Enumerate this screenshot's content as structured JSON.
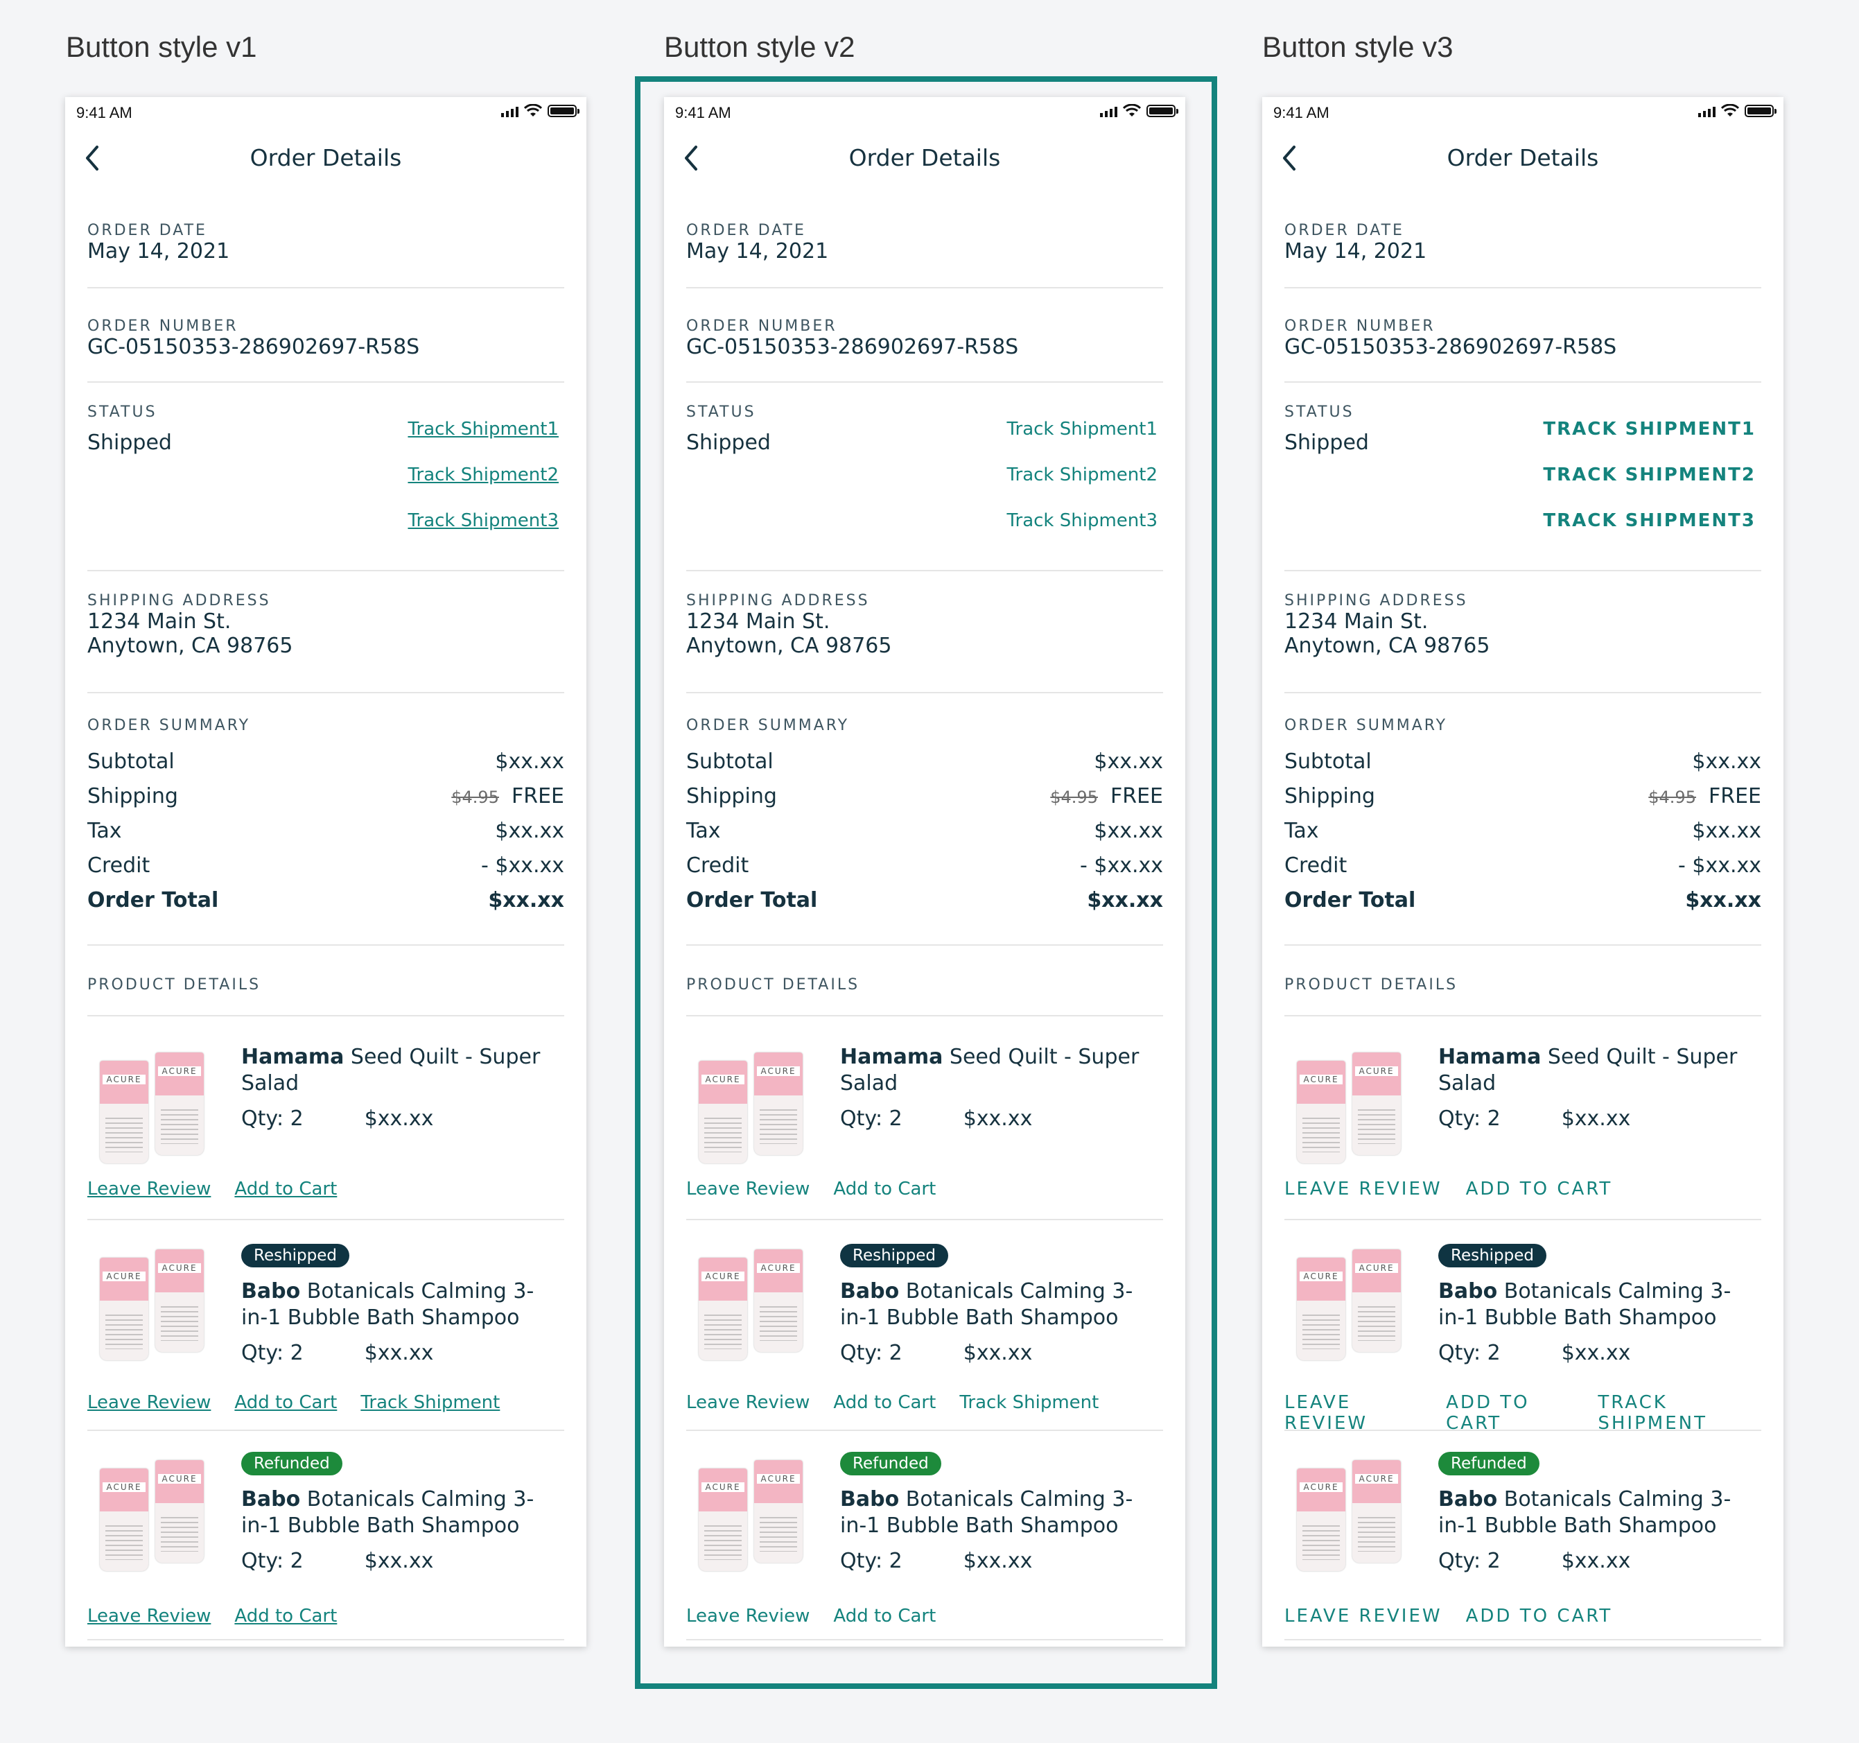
{
  "variants": [
    {
      "title": "Button style v1",
      "time": "9:41 AM",
      "nav_title": "Order Details",
      "order_date_label": "ORDER DATE",
      "order_date": "May 14, 2021",
      "order_number_label": "ORDER NUMBER",
      "order_number": "GC-05150353-286902697-R58S",
      "status_label": "STATUS",
      "status": "Shipped",
      "track_links": [
        "Track Shipment1",
        "Track Shipment2",
        "Track Shipment3"
      ],
      "address_label": "SHIPPING ADDRESS",
      "address_line1": "1234 Main St.",
      "address_line2": "Anytown, CA 98765",
      "summary_label": "ORDER SUMMARY",
      "summary": {
        "subtotal_label": "Subtotal",
        "subtotal": "$xx.xx",
        "shipping_label": "Shipping",
        "shipping_old": "$4.95",
        "shipping": "FREE",
        "tax_label": "Tax",
        "tax": "$xx.xx",
        "credit_label": "Credit",
        "credit": "- $xx.xx",
        "total_label": "Order Total",
        "total": "$xx.xx"
      },
      "products_label": "PRODUCT DETAILS",
      "products": [
        {
          "brand": "Hamama",
          "name": " Seed Quilt - Super Salad",
          "qty": "Qty: 2",
          "price": "$xx.xx",
          "badge": "",
          "actions": [
            "Leave Review",
            "Add to Cart"
          ]
        },
        {
          "brand": "Babo",
          "name": " Botanicals Calming 3-in-1 Bubble Bath Shampoo",
          "qty": "Qty: 2",
          "price": "$xx.xx",
          "badge": "Reshipped",
          "actions": [
            "Leave Review",
            "Add to Cart",
            "Track Shipment"
          ]
        },
        {
          "brand": "Babo",
          "name": " Botanicals Calming 3-in-1 Bubble Bath Shampoo",
          "qty": "Qty: 2",
          "price": "$xx.xx",
          "badge": "Refunded",
          "actions": [
            "Leave Review",
            "Add to Cart"
          ]
        }
      ]
    },
    {
      "title": "Button style v2",
      "time": "9:41 AM",
      "nav_title": "Order Details",
      "order_date_label": "ORDER DATE",
      "order_date": "May 14, 2021",
      "order_number_label": "ORDER NUMBER",
      "order_number": "GC-05150353-286902697-R58S",
      "status_label": "STATUS",
      "status": "Shipped",
      "track_links": [
        "Track Shipment1",
        "Track Shipment2",
        "Track Shipment3"
      ],
      "address_label": "SHIPPING ADDRESS",
      "address_line1": "1234 Main St.",
      "address_line2": "Anytown, CA 98765",
      "summary_label": "ORDER SUMMARY",
      "summary": {
        "subtotal_label": "Subtotal",
        "subtotal": "$xx.xx",
        "shipping_label": "Shipping",
        "shipping_old": "$4.95",
        "shipping": "FREE",
        "tax_label": "Tax",
        "tax": "$xx.xx",
        "credit_label": "Credit",
        "credit": "- $xx.xx",
        "total_label": "Order Total",
        "total": "$xx.xx"
      },
      "products_label": "PRODUCT DETAILS",
      "products": [
        {
          "brand": "Hamama",
          "name": " Seed Quilt - Super Salad",
          "qty": "Qty: 2",
          "price": "$xx.xx",
          "badge": "",
          "actions": [
            "Leave Review",
            "Add to Cart"
          ]
        },
        {
          "brand": "Babo",
          "name": " Botanicals Calming 3-in-1 Bubble Bath Shampoo",
          "qty": "Qty: 2",
          "price": "$xx.xx",
          "badge": "Reshipped",
          "actions": [
            "Leave Review",
            "Add to Cart",
            "Track Shipment"
          ]
        },
        {
          "brand": "Babo",
          "name": " Botanicals Calming 3-in-1 Bubble Bath Shampoo",
          "qty": "Qty: 2",
          "price": "$xx.xx",
          "badge": "Refunded",
          "actions": [
            "Leave Review",
            "Add to Cart"
          ]
        }
      ]
    },
    {
      "title": "Button style v3",
      "time": "9:41 AM",
      "nav_title": "Order Details",
      "order_date_label": "ORDER DATE",
      "order_date": "May 14, 2021",
      "order_number_label": "ORDER NUMBER",
      "order_number": "GC-05150353-286902697-R58S",
      "status_label": "STATUS",
      "status": "Shipped",
      "track_links": [
        "TRACK SHIPMENT1",
        "TRACK SHIPMENT2",
        "TRACK SHIPMENT3"
      ],
      "address_label": "SHIPPING ADDRESS",
      "address_line1": "1234 Main St.",
      "address_line2": "Anytown, CA 98765",
      "summary_label": "ORDER SUMMARY",
      "summary": {
        "subtotal_label": "Subtotal",
        "subtotal": "$xx.xx",
        "shipping_label": "Shipping",
        "shipping_old": "$4.95",
        "shipping": "FREE",
        "tax_label": "Tax",
        "tax": "$xx.xx",
        "credit_label": "Credit",
        "credit": "- $xx.xx",
        "total_label": "Order Total",
        "total": "$xx.xx"
      },
      "products_label": "PRODUCT DETAILS",
      "products": [
        {
          "brand": "Hamama",
          "name": " Seed Quilt - Super Salad",
          "qty": "Qty: 2",
          "price": "$xx.xx",
          "badge": "",
          "actions": [
            "LEAVE REVIEW",
            "ADD TO CART"
          ]
        },
        {
          "brand": "Babo",
          "name": " Botanicals Calming 3-in-1 Bubble Bath Shampoo",
          "qty": "Qty: 2",
          "price": "$xx.xx",
          "badge": "Reshipped",
          "actions": [
            "LEAVE REVIEW",
            "ADD TO CART",
            "TRACK SHIPMENT"
          ]
        },
        {
          "brand": "Babo",
          "name": " Botanicals Calming 3-in-1 Bubble Bath Shampoo",
          "qty": "Qty: 2",
          "price": "$xx.xx",
          "badge": "Refunded",
          "actions": [
            "LEAVE REVIEW",
            "ADD TO CART"
          ]
        }
      ]
    }
  ],
  "product_image_text": "ACURE",
  "colors": {
    "accent": "#14837d",
    "text": "#16323f",
    "reshipped_badge": "#0f3442",
    "refunded_badge": "#1d8a3b",
    "highlight_frame": "#14837d"
  },
  "selected_variant_index": 1
}
